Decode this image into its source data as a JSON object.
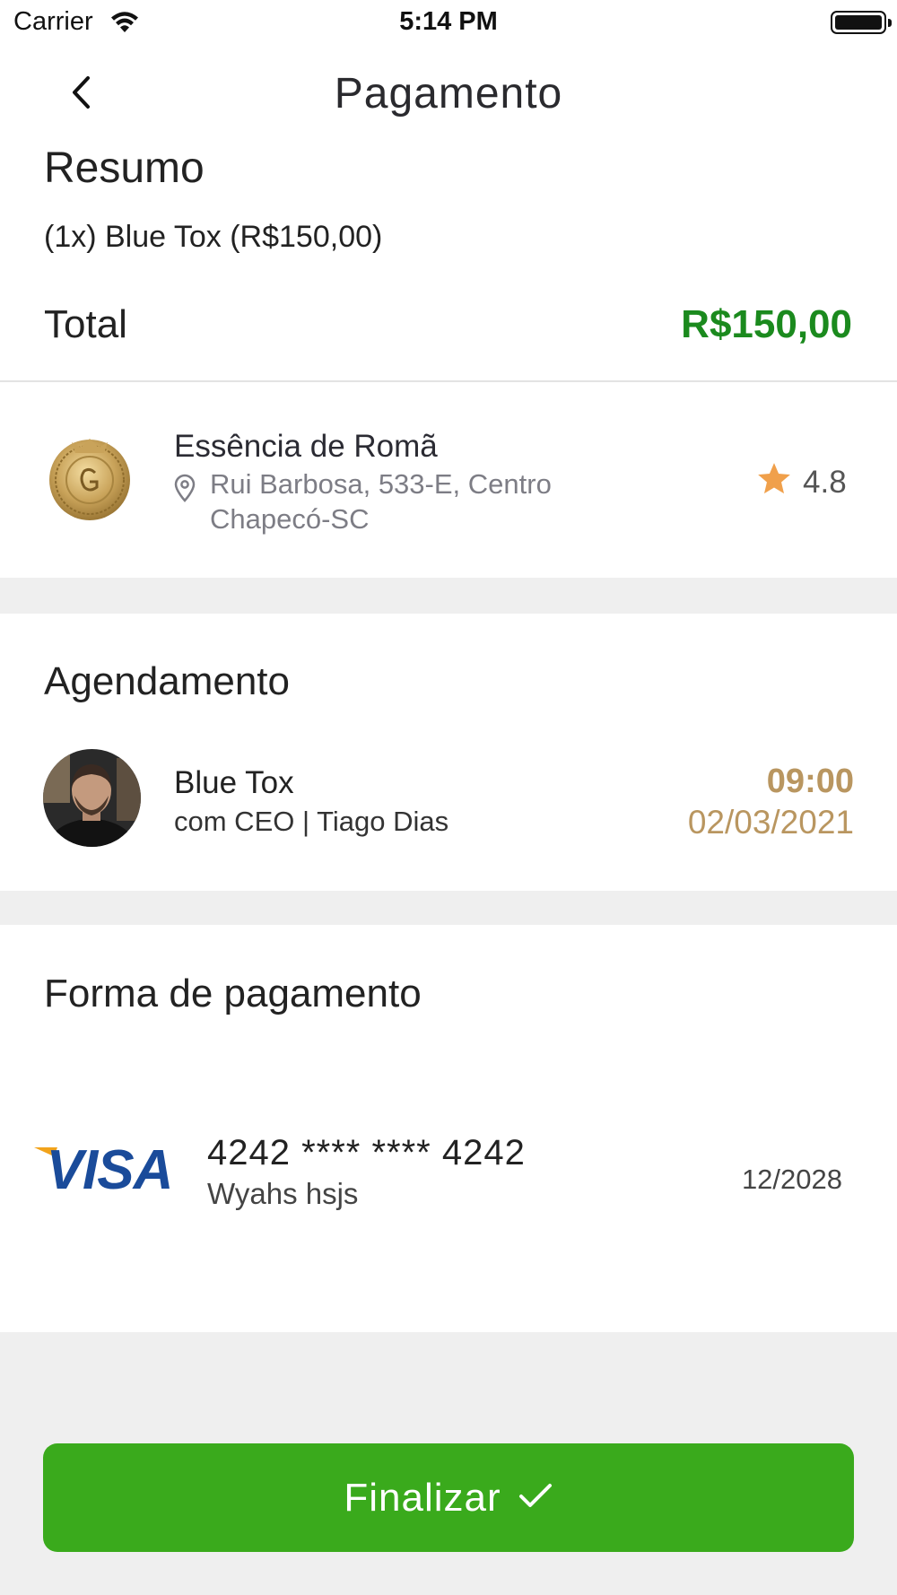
{
  "status_bar": {
    "carrier": "Carrier",
    "time": "5:14 PM"
  },
  "header": {
    "title": "Pagamento"
  },
  "summary": {
    "title": "Resumo",
    "item": "(1x) Blue Tox (R$150,00)",
    "total_label": "Total",
    "total_value": "R$150,00"
  },
  "establishment": {
    "name": "Essência de Romã",
    "address_line1": "Rui Barbosa, 533-E, Centro",
    "address_line2": "Chapecó-SC",
    "rating": "4.8"
  },
  "appointment": {
    "title": "Agendamento",
    "service": "Blue Tox",
    "professional": "com CEO | Tiago Dias",
    "time": "09:00",
    "date": "02/03/2021"
  },
  "payment": {
    "title": "Forma de pagamento",
    "card_number": "4242 **** **** 4242",
    "card_holder": "Wyahs hsjs",
    "card_expiry": "12/2028",
    "card_brand_text": "VISA"
  },
  "actions": {
    "finalize_label": "Finalizar"
  },
  "colors": {
    "total_green": "#1b8a1e",
    "gold": "#b99660",
    "button_green": "#3aaa1c",
    "star_orange": "#f0a04b",
    "visa_blue": "#1a4b9a",
    "visa_gold": "#f2a31b"
  },
  "icons": {
    "back": "chevron-left-icon",
    "location": "location-pin-icon",
    "rating": "star-icon",
    "confirm": "checkmark-icon"
  }
}
